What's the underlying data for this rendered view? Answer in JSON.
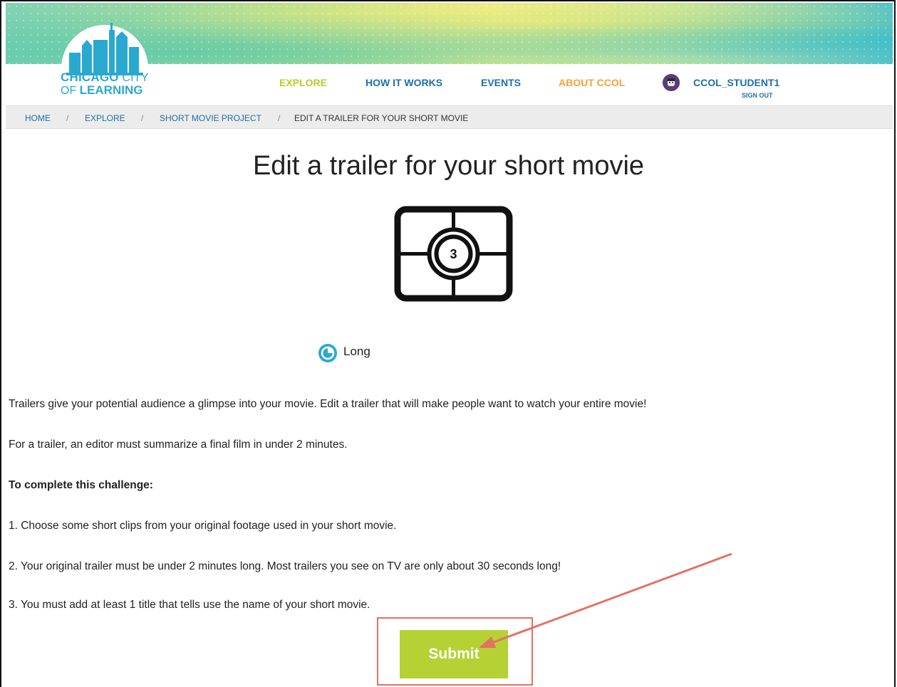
{
  "header": {
    "logo": {
      "line1_bold": "CHICAGO",
      "line1_thin": " CITY",
      "line2_thin": "OF ",
      "line2_bold": "LEARNING"
    },
    "nav": [
      {
        "label": "EXPLORE",
        "color": "#b8cc2b"
      },
      {
        "label": "HOW IT WORKS",
        "color": "#1d6fa8"
      },
      {
        "label": "EVENTS",
        "color": "#1d6fa8"
      },
      {
        "label": "ABOUT CCOL",
        "color": "#f2a33a"
      }
    ],
    "user": {
      "name": "CCOL_STUDENT1",
      "sign_out": "SIGN OUT",
      "avatar_icon": "user-avatar-icon"
    }
  },
  "breadcrumb": {
    "items": [
      "HOME",
      "EXPLORE",
      "SHORT MOVIE PROJECT"
    ],
    "separator": "/",
    "current": "EDIT A TRAILER FOR YOUR SHORT MOVIE"
  },
  "page": {
    "title": "Edit a trailer for your short movie",
    "badge_icon": "film-countdown-icon",
    "badge_number": "3",
    "duration": {
      "icon": "clock-icon",
      "label": "Long"
    },
    "paragraphs": [
      "Trailers give your potential audience a glimpse into your movie. Edit a trailer that will make people want to watch your entire movie!",
      "For a trailer, an editor must summarize a final film in under 2 minutes.",
      "To complete this challenge:",
      "1. Choose some short clips from your original footage used in your short movie.",
      "2. Your original trailer must be under 2 minutes long. Most trailers you see on TV are only about 30 seconds long!",
      "3. You must add at least 1 title that tells use the name of your short movie."
    ],
    "submit_label": "Submit"
  },
  "colors": {
    "brand_blue": "#2aa9d0",
    "link_blue": "#1d6fa8",
    "submit_green": "#b6d134",
    "annotation_red": "#e57063"
  }
}
